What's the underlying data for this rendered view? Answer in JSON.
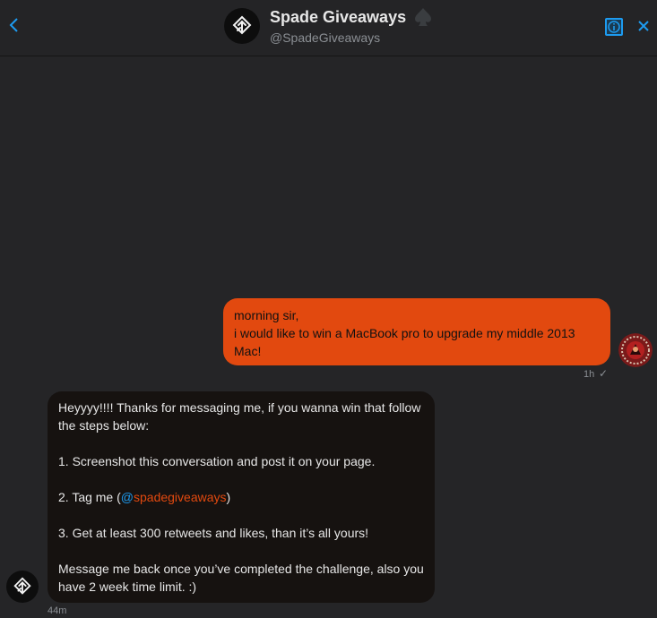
{
  "header": {
    "name": "Spade Giveaways",
    "handle": "@SpadeGiveaways",
    "back_icon": "chevron-left-icon",
    "info_icon": "info-icon",
    "close_icon": "close-icon",
    "accent_color": "#1d9bf0"
  },
  "messages": {
    "outgoing": {
      "lines": [
        "morning sir,",
        "i would like to win a MacBook pro to upgrade my middle 2013 Mac!"
      ],
      "time": "1h",
      "status_icon": "check-icon",
      "bubble_color": "#e2490f"
    },
    "incoming": {
      "p1": "Heyyyy!!!! Thanks for messaging me, if you wanna win that follow the steps below:",
      "p2": "1. Screenshot this conversation and post it on your page.",
      "p3_prefix": "2. Tag me (",
      "p3_at": "@",
      "p3_mention": "spadegiveaways",
      "p3_suffix": ")",
      "p4": "3. Get at least 300 retweets and likes, than it’s all yours!",
      "p5": "Message me back once you’ve completed the challenge, also you have 2 week time limit. :)",
      "time": "44m",
      "bubble_color": "#161210"
    }
  }
}
